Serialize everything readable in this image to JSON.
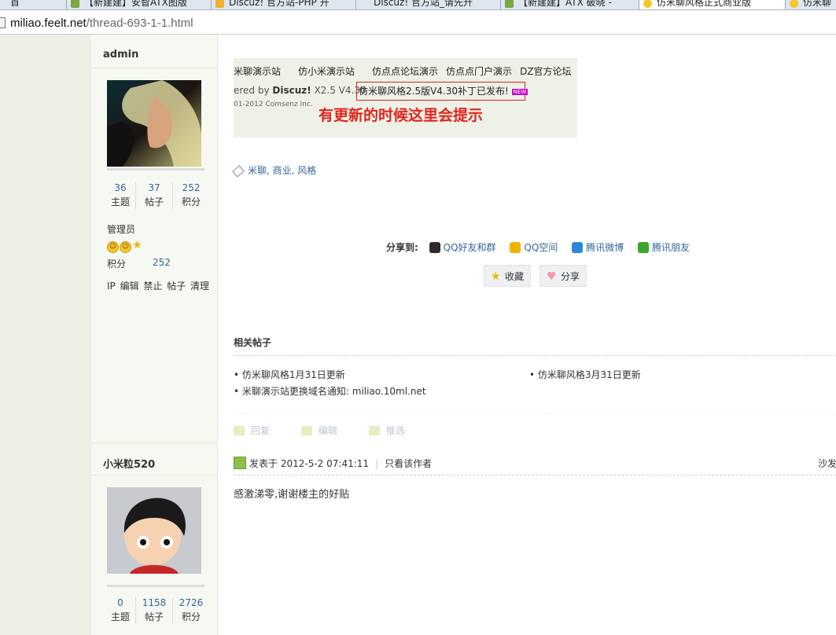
{
  "browser": {
    "tabs": [
      {
        "label": "首"
      },
      {
        "label": "【新建建】安智ATX图版 "
      },
      {
        "label": "Discuz! 官方站-PHP 开"
      },
      {
        "label": "Discuz! 官方站_请先升"
      },
      {
        "label": "【新建建】ATX 破晓 - "
      },
      {
        "label": "仿米聊风格正式商业版",
        "active": true
      },
      {
        "label": "仿米聊"
      }
    ],
    "url_host": "miliao.feelt.net",
    "url_path": "/thread-693-1-1.html"
  },
  "posts": [
    {
      "author": "admin",
      "stats": [
        {
          "value": "36",
          "label": "主题"
        },
        {
          "value": "37",
          "label": "帖子"
        },
        {
          "value": "252",
          "label": "积分"
        }
      ],
      "role": "管理员",
      "score_label": "积分",
      "score_value": "252",
      "admin_links": "IP 编辑 禁止 帖子 清理"
    },
    {
      "author": "小米粒520",
      "stats": [
        {
          "value": "0",
          "label": "主题"
        },
        {
          "value": "1158",
          "label": "帖子"
        },
        {
          "value": "2726",
          "label": "积分"
        }
      ]
    }
  ],
  "image": {
    "nav": [
      "米聊演示站",
      "仿小米演示站",
      "仿点点论坛演示",
      "仿点点门户演示",
      "DZ官方论坛"
    ],
    "powered_prefix": "ered by ",
    "powered_brand": "Discuz!",
    "powered_version": " X2.5 V4.30",
    "copyright": "01-2012 Comsenz Inc.",
    "notice": "仿米聊风格2.5版V4.30补丁已发布!",
    "new_badge": "NEW",
    "caption": "有更新的时候这里会提示"
  },
  "tags": "米聊, 商业, 风格",
  "share": {
    "label": "分享到:",
    "items": [
      "QQ好友和群",
      "QQ空间",
      "腾讯微博",
      "腾讯朋友"
    ]
  },
  "buttons": {
    "favorite": "收藏",
    "share": "分享"
  },
  "related": {
    "title": "相关帖子",
    "items": [
      "仿米聊风格1月31日更新",
      "仿米聊风格3月31日更新",
      "米聊演示站更换域名通知: miliao.10ml.net"
    ]
  },
  "actions": {
    "reply": "回复",
    "edit": "编辑",
    "promote": "推选"
  },
  "reply_post": {
    "posted_prefix": "发表于",
    "posted_time": "2012-5-2 07:41:11",
    "only_author": "只看该作者",
    "floor": "沙发",
    "body": "感激涕零,谢谢楼主的好贴"
  },
  "colors": {
    "link": "#336699",
    "highlight_red": "#e5231d",
    "sidebar_bg": "#f6f8f2"
  }
}
